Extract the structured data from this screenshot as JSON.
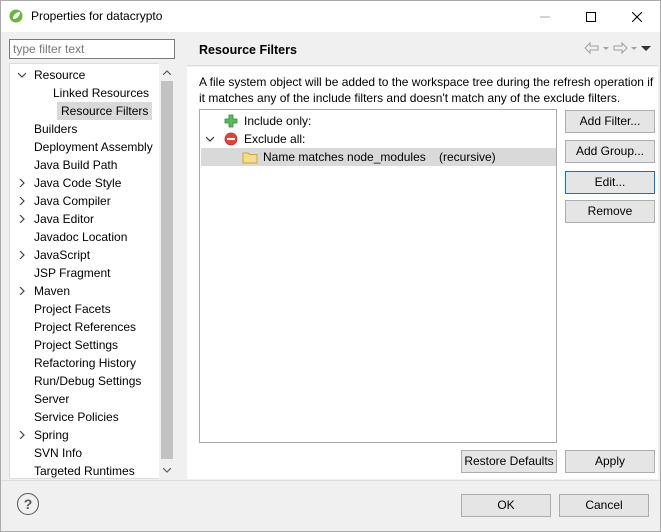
{
  "window": {
    "title": "Properties for datacrypto"
  },
  "filter": {
    "placeholder": "type filter text"
  },
  "tree": {
    "items": [
      {
        "label": "Resource",
        "expander": "open"
      },
      {
        "label": "Linked Resources",
        "expander": "none"
      },
      {
        "label": "Resource Filters",
        "expander": "none",
        "selected": true
      },
      {
        "label": "Builders",
        "expander": "none"
      },
      {
        "label": "Deployment Assembly",
        "expander": "none"
      },
      {
        "label": "Java Build Path",
        "expander": "none"
      },
      {
        "label": "Java Code Style",
        "expander": "closed"
      },
      {
        "label": "Java Compiler",
        "expander": "closed"
      },
      {
        "label": "Java Editor",
        "expander": "closed"
      },
      {
        "label": "Javadoc Location",
        "expander": "none"
      },
      {
        "label": "JavaScript",
        "expander": "closed"
      },
      {
        "label": "JSP Fragment",
        "expander": "none"
      },
      {
        "label": "Maven",
        "expander": "closed"
      },
      {
        "label": "Project Facets",
        "expander": "none"
      },
      {
        "label": "Project References",
        "expander": "none"
      },
      {
        "label": "Project Settings",
        "expander": "none"
      },
      {
        "label": "Refactoring History",
        "expander": "none"
      },
      {
        "label": "Run/Debug Settings",
        "expander": "none"
      },
      {
        "label": "Server",
        "expander": "none"
      },
      {
        "label": "Service Policies",
        "expander": "none"
      },
      {
        "label": "Spring",
        "expander": "closed"
      },
      {
        "label": "SVN Info",
        "expander": "none"
      },
      {
        "label": "Targeted Runtimes",
        "expander": "none"
      }
    ]
  },
  "page": {
    "title": "Resource Filters",
    "description": "A file system object will be added to the workspace tree during the refresh operation if it matches any of the include filters and doesn't match any of the exclude filters."
  },
  "filters": {
    "include_label": "Include only:",
    "exclude_label": "Exclude all:",
    "rule_name": "Name matches node_modules",
    "rule_suffix": "(recursive)"
  },
  "buttons": {
    "add_filter": "Add Filter...",
    "add_group": "Add Group...",
    "edit": "Edit...",
    "remove": "Remove",
    "restore_defaults": "Restore Defaults",
    "apply": "Apply",
    "ok": "OK",
    "cancel": "Cancel"
  },
  "colors": {
    "include_icon": "#3ca33c",
    "exclude_icon": "#d9342b",
    "folder_icon": "#e8c35a",
    "selection": "#d9d9d9",
    "focus": "#0078d7"
  }
}
